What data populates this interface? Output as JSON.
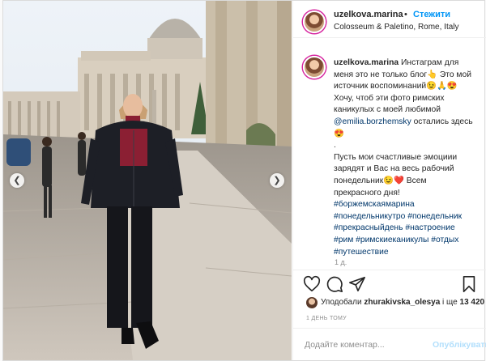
{
  "header": {
    "username": "uzelkova.marina",
    "dot": "•",
    "follow_label": "Стежити",
    "location": "Colosseum & Paletino, Rome, Italy"
  },
  "caption": {
    "username": "uzelkova.marina",
    "lines": [
      "Инстаграм для",
      "меня это не только блог👆 Это мой",
      "источник воспоминаний😉🙏😍",
      "Хочу, чтоб эти фото римских",
      "каникулых с моей любимой"
    ],
    "mention": "@emilia.borzhemsky",
    "after_mention": " остались здесь",
    "emoji_line": "😍",
    "dot_line": ".",
    "lines2": [
      "Пусть мои счастливые эмоциии",
      "зарядят и Вас на весь рабочий",
      "понедельник😉❤️ Всем",
      "прекрасного дня!"
    ],
    "hashtag_lines": [
      "#боржемскаямарина",
      "#понедельникутро #понедельник",
      "#прекрасныйдень #настроение",
      "#рим #римскиеканикулы #отдых",
      "#путешествие"
    ],
    "time": "1 д."
  },
  "likes": {
    "prefix": "Уподобали ",
    "user": "zhurakivska_olesya",
    "middle": " і ще ",
    "count": "13 420"
  },
  "time_ago": "1 ДЕНЬ ТОМУ",
  "comment": {
    "placeholder": "Додайте коментар...",
    "publish_label": "Опублікувати"
  },
  "icons": {
    "like": "heart-icon",
    "comment": "comment-icon",
    "share": "share-icon",
    "save": "bookmark-icon",
    "prev": "chevron-left-icon",
    "next": "chevron-right-icon"
  },
  "colors": {
    "follow": "#0095f6",
    "link": "#00376b",
    "publish_disabled": "#b2dffc"
  }
}
